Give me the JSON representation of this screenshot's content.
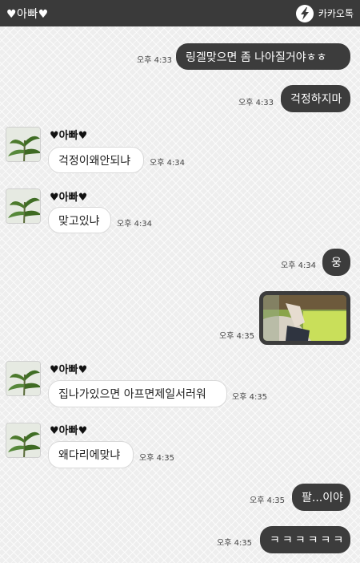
{
  "header": {
    "title": "♥아빠♥",
    "brand": "카카오톡"
  },
  "contact": {
    "name": "♥아빠♥"
  },
  "messages": [
    {
      "text": "링겔맞으면 좀 나아질거야ㅎㅎ",
      "time": "오후 4:33"
    },
    {
      "text": "걱정하지마",
      "time": "오후 4:33"
    },
    {
      "text": "걱정이왜안되냐",
      "time": "오후 4:34"
    },
    {
      "text": "맞고있냐",
      "time": "오후 4:34"
    },
    {
      "text": "웅",
      "time": "오후 4:34"
    },
    {
      "time": "오후 4:35"
    },
    {
      "text": "집나가있으면 아프면제일서러워",
      "time": "오후 4:35"
    },
    {
      "text": "왜다리에맞냐",
      "time": "오후 4:35"
    },
    {
      "text": "팔...이야",
      "time": "오후 4:35"
    },
    {
      "text": "ㅋㅋㅋㅋㅋㅋ",
      "time": "오후 4:35"
    }
  ]
}
